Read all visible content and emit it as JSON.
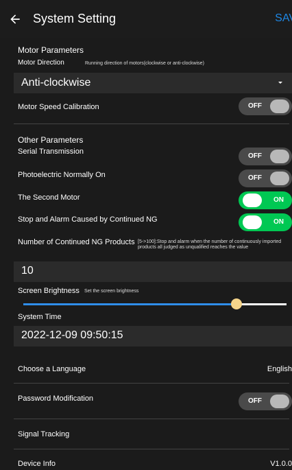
{
  "header": {
    "title": "System Setting",
    "save_label": "SAV"
  },
  "motor": {
    "section_title": "Motor Parameters",
    "direction_label": "Motor Direction",
    "direction_hint": "Running direction of motors(clockwise or anti-clockwise)",
    "direction_value": "Anti-clockwise",
    "speed_cal_label": "Motor Speed Calibration",
    "speed_cal_state": "OFF"
  },
  "other": {
    "section_title": "Other Parameters",
    "serial_label": "Serial Transmission",
    "serial_state": "OFF",
    "photo_label": "Photoelectric Normally On",
    "photo_state": "OFF",
    "second_motor_label": "The Second Motor",
    "second_motor_state": "ON",
    "stop_alarm_label": "Stop and Alarm Caused by Continued NG",
    "stop_alarm_state": "ON",
    "ng_label": "Number of Continued NG Products",
    "ng_hint": "[5->100]:Stop and alarm when the number of continuously imported products all judged as unqualified reaches the value",
    "ng_value": "10",
    "brightness_label": "Screen Brightness",
    "brightness_hint": "Set the screen brightness",
    "brightness_level": 0.81,
    "time_label": "System Time",
    "time_value": "2022-12-09 09:50:15",
    "language_label": "Choose a Language",
    "language_value": "English",
    "password_label": "Password Modification",
    "password_state": "OFF",
    "signal_label": "Signal Tracking",
    "device_label": "Device Info",
    "device_value": "V1.0.0"
  },
  "colors": {
    "accent": "#1e88e5",
    "toggle_on": "#00c853",
    "toggle_off": "#4a4a4a"
  },
  "icons": {
    "back": "arrow-left",
    "dropdown": "caret-down"
  }
}
